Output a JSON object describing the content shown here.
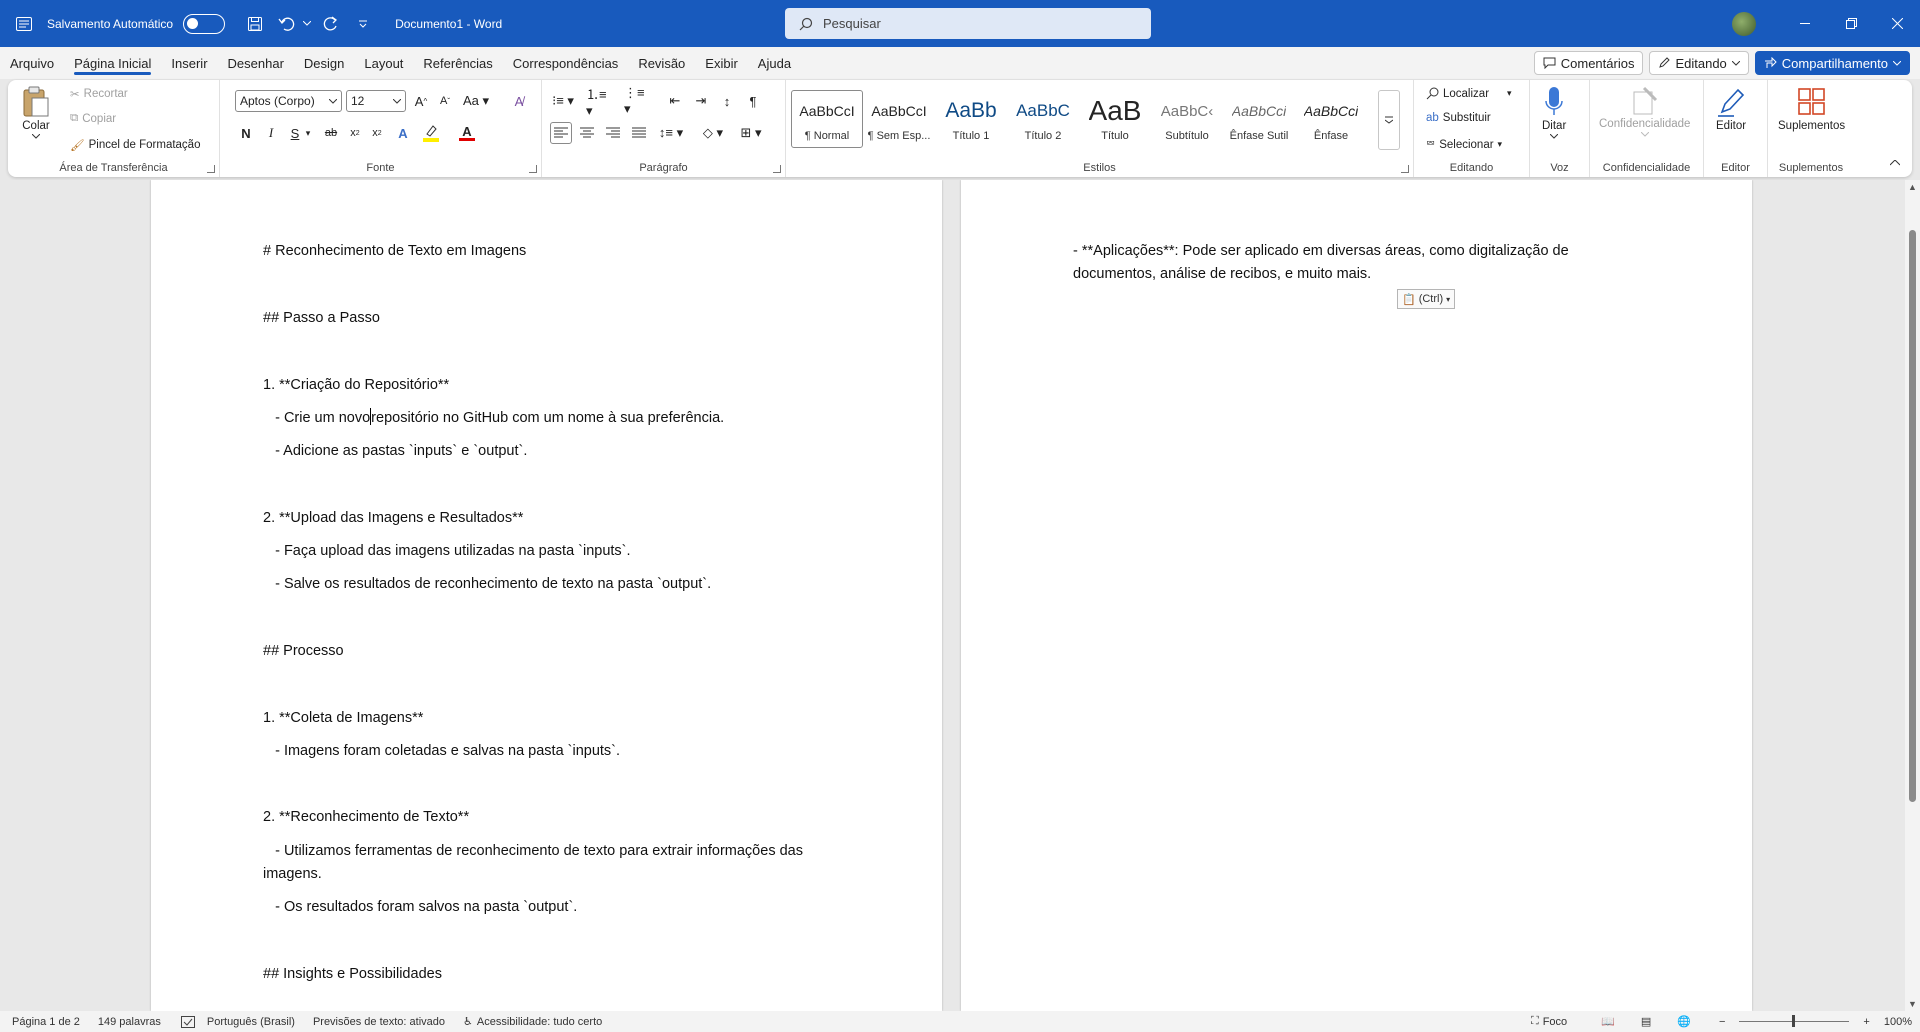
{
  "titlebar": {
    "autosave_label": "Salvamento Automático",
    "document_title": "Documento1  -  Word",
    "search_placeholder": "Pesquisar"
  },
  "menu": {
    "tabs": [
      "Arquivo",
      "Página Inicial",
      "Inserir",
      "Desenhar",
      "Design",
      "Layout",
      "Referências",
      "Correspondências",
      "Revisão",
      "Exibir",
      "Ajuda"
    ],
    "active_tab": "Página Inicial",
    "comments": "Comentários",
    "editing": "Editando",
    "share": "Compartilhamento"
  },
  "ribbon": {
    "clipboard": {
      "paste": "Colar",
      "cut": "Recortar",
      "copy": "Copiar",
      "format_painter": "Pincel de Formatação",
      "label": "Área de Transferência"
    },
    "font": {
      "name": "Aptos (Corpo)",
      "size": "12",
      "label": "Fonte",
      "bold": "N",
      "italic": "I",
      "underline": "S"
    },
    "paragraph": {
      "label": "Parágrafo"
    },
    "styles": {
      "label": "Estilos",
      "items": [
        {
          "preview": "AaBbCcI",
          "name": "¶ Normal"
        },
        {
          "preview": "AaBbCcI",
          "name": "¶ Sem Esp..."
        },
        {
          "preview": "AaBb",
          "name": "Título 1"
        },
        {
          "preview": "AaBbC",
          "name": "Título 2"
        },
        {
          "preview": "AaB",
          "name": "Título"
        },
        {
          "preview": "AaBbC‹",
          "name": "Subtítulo"
        },
        {
          "preview": "AaBbCci",
          "name": "Ênfase Sutil"
        },
        {
          "preview": "AaBbCci",
          "name": "Ênfase"
        }
      ]
    },
    "editing": {
      "find": "Localizar",
      "replace": "Substituir",
      "select": "Selecionar",
      "label": "Editando"
    },
    "voice": {
      "dictate": "Ditar",
      "label": "Voz"
    },
    "sensitivity": {
      "name": "Confidencialidade",
      "label": "Confidencialidade"
    },
    "editor": {
      "name": "Editor",
      "label": "Editor"
    },
    "addins": {
      "name": "Suplementos",
      "label": "Suplementos"
    }
  },
  "document": {
    "page1": [
      "# Reconhecimento de Texto em Imagens",
      "## Passo a Passo",
      "1. **Criação do Repositório**",
      "   - Crie um novo",
      "repositório no GitHub com um nome à sua preferência.",
      "   - Adicione as pastas `inputs` e `output`.",
      "2. **Upload das Imagens e Resultados**",
      "   - Faça upload das imagens utilizadas na pasta `inputs`.",
      "   - Salve os resultados de reconhecimento de texto na pasta `output`.",
      "## Processo",
      "1. **Coleta de Imagens**",
      "   - Imagens foram coletadas e salvas na pasta `inputs`.",
      "2. **Reconhecimento de Texto**",
      "   - Utilizamos ferramentas de reconhecimento de texto para extrair informações das imagens.",
      "   - Os resultados foram salvos na pasta `output`.",
      "## Insights e Possibilidades"
    ],
    "page2": [
      "- **Aplicações**: Pode ser aplicado em diversas áreas, como digitalização de documentos, análise de recibos, e muito mais."
    ],
    "paste_options": "(Ctrl)"
  },
  "statusbar": {
    "page": "Página 1 de 2",
    "words": "149 palavras",
    "language": "Português (Brasil)",
    "predictions": "Previsões de texto: ativado",
    "accessibility": "Acessibilidade: tudo certo",
    "focus": "Foco",
    "zoom": "100%"
  }
}
